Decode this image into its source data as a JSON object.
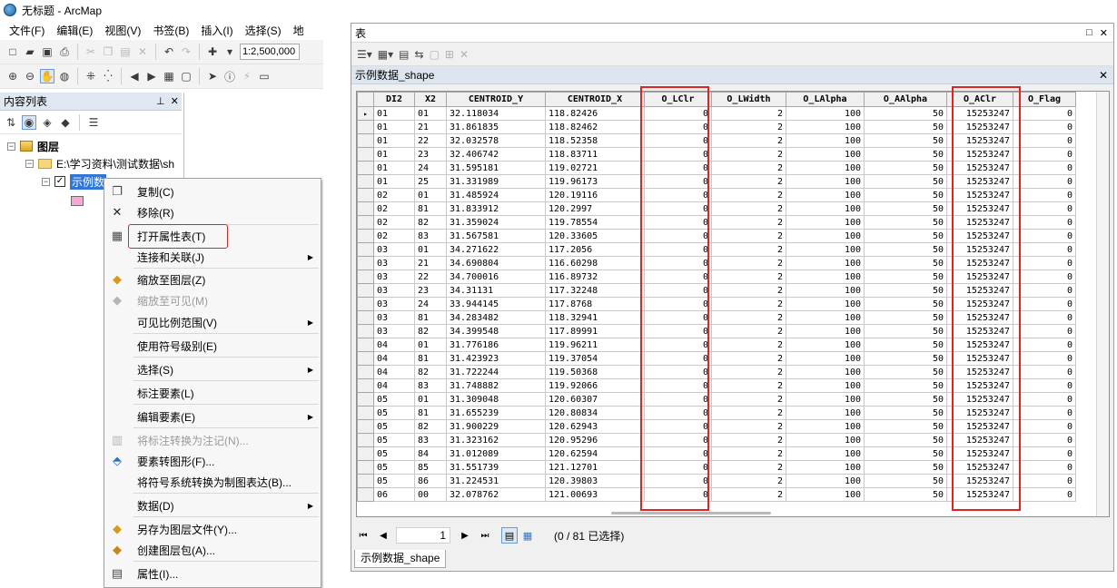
{
  "arcmap": {
    "title": "无标题 - ArcMap",
    "menu": [
      "文件(F)",
      "编辑(E)",
      "视图(V)",
      "书签(B)",
      "插入(I)",
      "选择(S)",
      "地"
    ],
    "scale": "1:2,500,000",
    "toc": {
      "title": "内容列表",
      "root_label": "图层",
      "folder_label": "E:\\学习资料\\测试数据\\sh",
      "layer_label": "示例数"
    },
    "context_menu": [
      {
        "label": "复制(C)",
        "icon": "copy-icon",
        "disabled": false,
        "submenu": false
      },
      {
        "label": "移除(R)",
        "icon": "remove-icon",
        "disabled": false,
        "submenu": false
      },
      {
        "label": "打开属性表(T)",
        "icon": "table-icon",
        "disabled": false,
        "submenu": false,
        "highlighted": true
      },
      {
        "label": "连接和关联(J)",
        "icon": "",
        "disabled": false,
        "submenu": true
      },
      {
        "label": "缩放至图层(Z)",
        "icon": "zoom-layer-icon",
        "disabled": false,
        "submenu": false
      },
      {
        "label": "缩放至可见(M)",
        "icon": "zoom-visible-icon",
        "disabled": true,
        "submenu": false
      },
      {
        "label": "可见比例范围(V)",
        "icon": "",
        "disabled": false,
        "submenu": true
      },
      {
        "label": "使用符号级别(E)",
        "icon": "",
        "disabled": false,
        "submenu": false
      },
      {
        "label": "选择(S)",
        "icon": "",
        "disabled": false,
        "submenu": true
      },
      {
        "label": "标注要素(L)",
        "icon": "",
        "disabled": false,
        "submenu": false
      },
      {
        "label": "编辑要素(E)",
        "icon": "",
        "disabled": false,
        "submenu": true
      },
      {
        "label": "将标注转换为注记(N)...",
        "icon": "convert-label-icon",
        "disabled": true,
        "submenu": false
      },
      {
        "label": "要素转图形(F)...",
        "icon": "feature-graphics-icon",
        "disabled": false,
        "submenu": false
      },
      {
        "label": "将符号系统转换为制图表达(B)...",
        "icon": "",
        "disabled": false,
        "submenu": false
      },
      {
        "label": "数据(D)",
        "icon": "",
        "disabled": false,
        "submenu": true
      },
      {
        "label": "另存为图层文件(Y)...",
        "icon": "layer-file-icon",
        "disabled": false,
        "submenu": false
      },
      {
        "label": "创建图层包(A)...",
        "icon": "layer-package-icon",
        "disabled": false,
        "submenu": false
      },
      {
        "label": "属性(I)...",
        "icon": "properties-icon",
        "disabled": false,
        "submenu": false
      }
    ]
  },
  "table_window": {
    "title": "表",
    "table_name": "示例数据_shape",
    "columns": [
      "DI2",
      "X2",
      "CENTROID_Y",
      "CENTROID_X",
      "O_LClr",
      "O_LWidth",
      "O_LAlpha",
      "O_AAlpha",
      "O_AClr",
      "O_Flag"
    ],
    "rows": [
      [
        "01",
        "01",
        "32.118034",
        "118.82426",
        "0",
        "2",
        "100",
        "50",
        "15253247",
        "0"
      ],
      [
        "01",
        "21",
        "31.861835",
        "118.82462",
        "0",
        "2",
        "100",
        "50",
        "15253247",
        "0"
      ],
      [
        "01",
        "22",
        "32.032578",
        "118.52358",
        "0",
        "2",
        "100",
        "50",
        "15253247",
        "0"
      ],
      [
        "01",
        "23",
        "32.406742",
        "118.83711",
        "0",
        "2",
        "100",
        "50",
        "15253247",
        "0"
      ],
      [
        "01",
        "24",
        "31.595181",
        "119.02721",
        "0",
        "2",
        "100",
        "50",
        "15253247",
        "0"
      ],
      [
        "01",
        "25",
        "31.331989",
        "119.96173",
        "0",
        "2",
        "100",
        "50",
        "15253247",
        "0"
      ],
      [
        "02",
        "01",
        "31.485924",
        "120.19116",
        "0",
        "2",
        "100",
        "50",
        "15253247",
        "0"
      ],
      [
        "02",
        "81",
        "31.833912",
        "120.2997",
        "0",
        "2",
        "100",
        "50",
        "15253247",
        "0"
      ],
      [
        "02",
        "82",
        "31.359024",
        "119.78554",
        "0",
        "2",
        "100",
        "50",
        "15253247",
        "0"
      ],
      [
        "02",
        "83",
        "31.567581",
        "120.33605",
        "0",
        "2",
        "100",
        "50",
        "15253247",
        "0"
      ],
      [
        "03",
        "01",
        "34.271622",
        "117.2056",
        "0",
        "2",
        "100",
        "50",
        "15253247",
        "0"
      ],
      [
        "03",
        "21",
        "34.690804",
        "116.60298",
        "0",
        "2",
        "100",
        "50",
        "15253247",
        "0"
      ],
      [
        "03",
        "22",
        "34.700016",
        "116.89732",
        "0",
        "2",
        "100",
        "50",
        "15253247",
        "0"
      ],
      [
        "03",
        "23",
        "34.31131",
        "117.32248",
        "0",
        "2",
        "100",
        "50",
        "15253247",
        "0"
      ],
      [
        "03",
        "24",
        "33.944145",
        "117.8768",
        "0",
        "2",
        "100",
        "50",
        "15253247",
        "0"
      ],
      [
        "03",
        "81",
        "34.283482",
        "118.32941",
        "0",
        "2",
        "100",
        "50",
        "15253247",
        "0"
      ],
      [
        "03",
        "82",
        "34.399548",
        "117.89991",
        "0",
        "2",
        "100",
        "50",
        "15253247",
        "0"
      ],
      [
        "04",
        "01",
        "31.776186",
        "119.96211",
        "0",
        "2",
        "100",
        "50",
        "15253247",
        "0"
      ],
      [
        "04",
        "81",
        "31.423923",
        "119.37054",
        "0",
        "2",
        "100",
        "50",
        "15253247",
        "0"
      ],
      [
        "04",
        "82",
        "31.722244",
        "119.50368",
        "0",
        "2",
        "100",
        "50",
        "15253247",
        "0"
      ],
      [
        "04",
        "83",
        "31.748882",
        "119.92066",
        "0",
        "2",
        "100",
        "50",
        "15253247",
        "0"
      ],
      [
        "05",
        "01",
        "31.309048",
        "120.60307",
        "0",
        "2",
        "100",
        "50",
        "15253247",
        "0"
      ],
      [
        "05",
        "81",
        "31.655239",
        "120.80834",
        "0",
        "2",
        "100",
        "50",
        "15253247",
        "0"
      ],
      [
        "05",
        "82",
        "31.900229",
        "120.62943",
        "0",
        "2",
        "100",
        "50",
        "15253247",
        "0"
      ],
      [
        "05",
        "83",
        "31.323162",
        "120.95296",
        "0",
        "2",
        "100",
        "50",
        "15253247",
        "0"
      ],
      [
        "05",
        "84",
        "31.012089",
        "120.62594",
        "0",
        "2",
        "100",
        "50",
        "15253247",
        "0"
      ],
      [
        "05",
        "85",
        "31.551739",
        "121.12701",
        "0",
        "2",
        "100",
        "50",
        "15253247",
        "0"
      ],
      [
        "05",
        "86",
        "31.224531",
        "120.39803",
        "0",
        "2",
        "100",
        "50",
        "15253247",
        "0"
      ],
      [
        "06",
        "00",
        "32.078762",
        "121.00693",
        "0",
        "2",
        "100",
        "50",
        "15253247",
        "0"
      ]
    ],
    "numeric_columns": [
      4,
      5,
      6,
      7,
      8,
      9
    ],
    "current_row_marker": "▸",
    "page": "1",
    "status": "(0 / 81 已选择)",
    "tab_label": "示例数据_shape"
  },
  "colors": {
    "highlight_red": "#e02424",
    "selection_blue": "#3375d6"
  }
}
